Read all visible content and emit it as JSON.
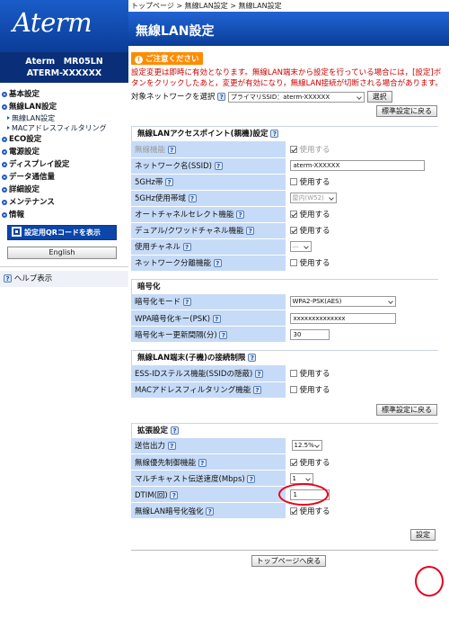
{
  "sidebar": {
    "logo": "Aterm",
    "model_line1": "Aterm　MR05LN",
    "model_line2": "ATERM-XXXXXX",
    "items": [
      {
        "label": "基本設定"
      },
      {
        "label": "無線LAN設定"
      },
      {
        "label": "ECO設定"
      },
      {
        "label": "電源設定"
      },
      {
        "label": "ディスプレイ設定"
      },
      {
        "label": "データ通信量"
      },
      {
        "label": "詳細設定"
      },
      {
        "label": "メンテナンス"
      },
      {
        "label": "情報"
      }
    ],
    "sub_items": [
      {
        "label": "無線LAN設定"
      },
      {
        "label": "MACアドレスフィルタリング"
      }
    ],
    "qr_button": "設定用QRコードを表示",
    "english_button": "English",
    "help": "ヘルプ表示"
  },
  "main": {
    "breadcrumb": "トップページ > 無線LAN設定 > 無線LAN設定",
    "title": "無線LAN設定",
    "notice_label": "ご注意ください",
    "notice_text": "設定変更は即時に有効となります。無線LAN端末から設定を行っている場合には，[設定]ボタンをクリックしたあと，変更が有効になり，無線LAN接続が切断される場合があります。",
    "target_label": "対象ネットワークを選択",
    "target_value": "プライマリSSID：aterm-XXXXXX",
    "select_button": "選択",
    "reset_button": "標準設定に戻る",
    "help_q": "?",
    "sections": {
      "ap": {
        "title": "無線LANアクセスポイント(親機)設定",
        "rows": [
          {
            "label": "無線機能",
            "value": "使用する"
          },
          {
            "label": "ネットワーク名(SSID)",
            "value": "aterm-XXXXXX"
          },
          {
            "label": "5GHz帯",
            "value": "使用する"
          },
          {
            "label": "5GHz使用帯域",
            "value": "屋内(W52)"
          },
          {
            "label": "オートチャネルセレクト機能",
            "value": "使用する"
          },
          {
            "label": "デュアル/クワッドチャネル機能",
            "value": "使用する"
          },
          {
            "label": "使用チャネル",
            "value": "―"
          },
          {
            "label": "ネットワーク分離機能",
            "value": "使用する"
          }
        ]
      },
      "enc": {
        "title": "暗号化",
        "rows": [
          {
            "label": "暗号化モード",
            "value": "WPA2-PSK(AES)"
          },
          {
            "label": "WPA暗号化キー(PSK)",
            "value": "xxxxxxxxxxxxxx"
          },
          {
            "label": "暗号化キー更新間隔(分)",
            "value": "30"
          }
        ]
      },
      "client": {
        "title": "無線LAN端末(子機)の接続制限",
        "rows": [
          {
            "label": "ESS-IDステルス機能(SSIDの隠蔽)",
            "value": "使用する"
          },
          {
            "label": "MACアドレスフィルタリング機能",
            "value": "使用する"
          }
        ]
      },
      "ext": {
        "title": "拡張設定",
        "rows": [
          {
            "label": "送信出力",
            "value": "12.5%"
          },
          {
            "label": "無線優先制御機能",
            "value": "使用する"
          },
          {
            "label": "マルチキャスト伝送速度(Mbps)",
            "value": "1"
          },
          {
            "label": "DTIM(回)",
            "value": "1"
          },
          {
            "label": "無線LAN暗号化強化",
            "value": "使用する"
          }
        ]
      }
    },
    "apply_button": "設定",
    "top_button": "トップページへ戻る"
  }
}
